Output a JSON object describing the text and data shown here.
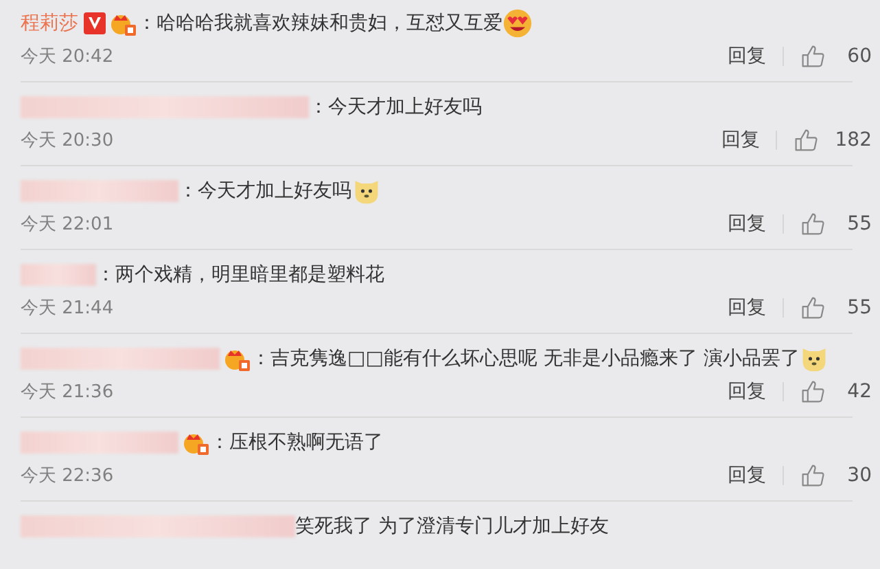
{
  "comments": [
    {
      "author": {
        "kind": "named",
        "text": "程莉莎"
      },
      "verified": true,
      "crown": true,
      "text": "：哈哈哈我就喜欢辣妹和贵妇，互怼又互爱",
      "emoji": {
        "kind": "heart-eyes"
      },
      "time": "今天 20:42",
      "reply": "回复",
      "likes": "60"
    },
    {
      "author": {
        "kind": "redacted"
      },
      "verified": false,
      "crown": false,
      "text": "：今天才加上好友吗",
      "time": "今天 20:30",
      "reply": "回复",
      "likes": "182"
    },
    {
      "author": {
        "kind": "redacted"
      },
      "verified": false,
      "crown": false,
      "text": "：今天才加上好友吗",
      "emoji": {
        "kind": "dog"
      },
      "time": "今天 22:01",
      "reply": "回复",
      "likes": "55"
    },
    {
      "author": {
        "kind": "redacted"
      },
      "verified": false,
      "crown": false,
      "text": "：两个戏精，明里暗里都是塑料花",
      "time": "今天 21:44",
      "reply": "回复",
      "likes": "55"
    },
    {
      "author": {
        "kind": "redacted"
      },
      "verified": false,
      "crown": true,
      "text": "：吉克隽逸□□能有什么坏心思呢 无非是小品瘾来了 演小品罢了",
      "emoji": {
        "kind": "dog"
      },
      "time": "今天 21:36",
      "reply": "回复",
      "likes": "42"
    },
    {
      "author": {
        "kind": "redacted"
      },
      "verified": false,
      "crown": true,
      "text": "：压根不熟啊无语了",
      "time": "今天 22:36",
      "reply": "回复",
      "likes": "30"
    },
    {
      "author": {
        "kind": "redacted"
      },
      "verified": false,
      "crown": false,
      "text": "笑死我了 为了澄清专门儿才加上好友"
    }
  ]
}
